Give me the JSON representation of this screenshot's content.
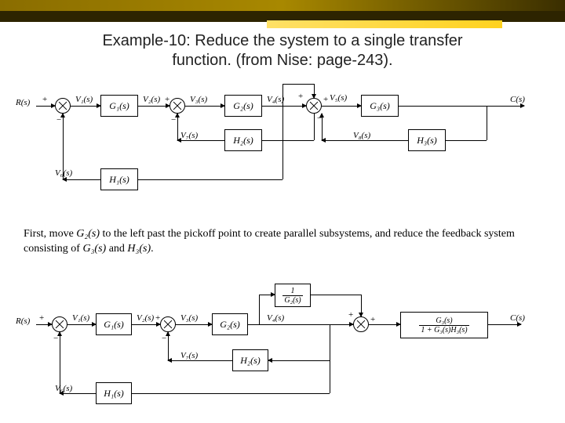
{
  "title_line1": "Example-10: Reduce the system to a single transfer",
  "title_line2": "function. (from Nise: page-243).",
  "paragraph_pre": "First, move ",
  "paragraph_g2": "G₂(s)",
  "paragraph_mid1": " to the left past the pickoff point to create parallel subsystems, and reduce the feedback system consisting of ",
  "paragraph_g3": "G₃(s)",
  "paragraph_and": " and ",
  "paragraph_h3": "H₃(s)",
  "paragraph_end": ".",
  "signals": {
    "R": "R(s)",
    "C": "C(s)",
    "V1": "V₁(s)",
    "V2": "V₂(s)",
    "V3": "V₃(s)",
    "V4": "V₄(s)",
    "V5": "V₅(s)",
    "V6": "V₆(s)",
    "V7": "V₇(s)",
    "V8": "V₈(s)"
  },
  "blocks": {
    "G1": "G₁(s)",
    "G2": "G₂(s)",
    "G3": "G₃(s)",
    "H1": "H₁(s)",
    "H2": "H₂(s)",
    "H3": "H₃(s)",
    "invG2_num": "1",
    "invG2_den": "G₂(s)",
    "cl_num": "G₃(s)",
    "cl_den": "1 + G₃(s)H₃(s)"
  },
  "signs": {
    "plus": "+",
    "minus": "−"
  }
}
